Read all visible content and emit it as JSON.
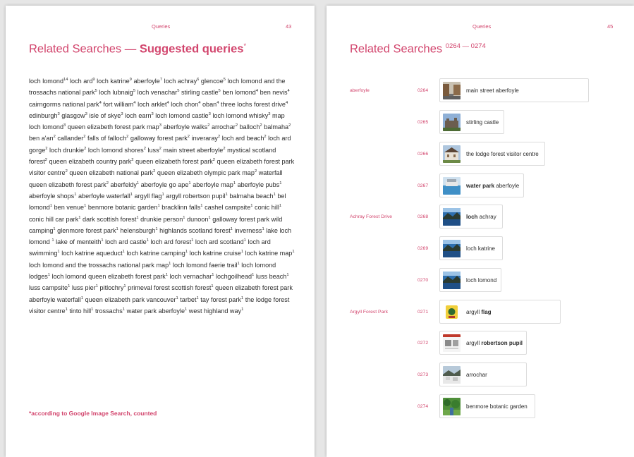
{
  "left_page": {
    "section": "Queries",
    "page_number": "43",
    "title_light": "Related Searches — ",
    "title_bold": "Suggested queries",
    "title_mark": "*",
    "terms": [
      {
        "t": "loch lomond",
        "n": "14"
      },
      {
        "t": "loch ard",
        "n": "9"
      },
      {
        "t": "loch katrine",
        "n": "9"
      },
      {
        "t": "aberfoyle",
        "n": "7"
      },
      {
        "t": "loch achray",
        "n": "6"
      },
      {
        "t": "glencoe",
        "n": "5"
      },
      {
        "t": "loch lomond and the trossachs national park",
        "n": "5"
      },
      {
        "t": "loch lubnaig",
        "n": "5"
      },
      {
        "t": "loch venachar",
        "n": "5"
      },
      {
        "t": "stirling castle",
        "n": "5"
      },
      {
        "t": "ben lomond",
        "n": "4"
      },
      {
        "t": "ben nevis",
        "n": "4"
      },
      {
        "t": "cairngorms national park",
        "n": "4"
      },
      {
        "t": "fort william",
        "n": "4"
      },
      {
        "t": "loch arklet",
        "n": "4"
      },
      {
        "t": "loch chon",
        "n": "4"
      },
      {
        "t": "oban",
        "n": "4"
      },
      {
        "t": "three lochs forest drive",
        "n": "4"
      },
      {
        "t": "edinburgh",
        "n": "3"
      },
      {
        "t": "glasgow",
        "n": "3"
      },
      {
        "t": "isle of skye",
        "n": "3"
      },
      {
        "t": "loch earn",
        "n": "3"
      },
      {
        "t": "loch lomond castle",
        "n": "3"
      },
      {
        "t": "loch lomond whisky",
        "n": "3"
      },
      {
        "t": "map loch lomond",
        "n": "3"
      },
      {
        "t": "queen elizabeth forest park map",
        "n": "3"
      },
      {
        "t": "aberfoyle walks",
        "n": "2"
      },
      {
        "t": "arrochar",
        "n": "2"
      },
      {
        "t": "balloch",
        "n": "2"
      },
      {
        "t": "balmaha",
        "n": "2"
      },
      {
        "t": "ben a'an",
        "n": "2"
      },
      {
        "t": "callander",
        "n": "2"
      },
      {
        "t": "falls of falloch",
        "n": "2"
      },
      {
        "t": "galloway forest park",
        "n": "2"
      },
      {
        "t": "inveraray",
        "n": "2"
      },
      {
        "t": "loch ard beach",
        "n": "2"
      },
      {
        "t": "loch ard gorge",
        "n": "2"
      },
      {
        "t": "loch drunkie",
        "n": "2"
      },
      {
        "t": "loch lomond shores",
        "n": "2"
      },
      {
        "t": "luss",
        "n": "2"
      },
      {
        "t": "main street aberfoyle",
        "n": "2"
      },
      {
        "t": "mystical scotland forest",
        "n": "2"
      },
      {
        "t": "queen elizabeth country park",
        "n": "2"
      },
      {
        "t": "queen elizabeth forest park",
        "n": "2"
      },
      {
        "t": "queen elizabeth forest park visitor centre",
        "n": "2"
      },
      {
        "t": "queen elizabeth national park",
        "n": "2"
      },
      {
        "t": "queen elizabeth olympic park map",
        "n": "2"
      },
      {
        "t": "waterfall queen elizabeth forest park",
        "n": "2"
      },
      {
        "t": "aberfeldy",
        "n": "1"
      },
      {
        "t": "aberfoyle go ape",
        "n": "1"
      },
      {
        "t": "aberfoyle map",
        "n": "1"
      },
      {
        "t": "aberfoyle pubs",
        "n": "1"
      },
      {
        "t": "aberfoyle shops",
        "n": "1"
      },
      {
        "t": "aberfoyle waterfall",
        "n": "1"
      },
      {
        "t": "argyll flag",
        "n": "1"
      },
      {
        "t": "argyll robertson pupil",
        "n": "1"
      },
      {
        "t": "balmaha beach",
        "n": "1"
      },
      {
        "t": "bel lomond",
        "n": "1"
      },
      {
        "t": "ben venue",
        "n": "1"
      },
      {
        "t": "benmore botanic garden",
        "n": "1"
      },
      {
        "t": "bracklinn falls",
        "n": "1"
      },
      {
        "t": "cashel campsite",
        "n": "1"
      },
      {
        "t": "conic hill",
        "n": "1"
      },
      {
        "t": "conic hill car park",
        "n": "1"
      },
      {
        "t": "dark scottish forest",
        "n": "1"
      },
      {
        "t": "drunkie person",
        "n": "1"
      },
      {
        "t": "dunoon",
        "n": "1"
      },
      {
        "t": "galloway forest park wild camping",
        "n": "1"
      },
      {
        "t": "glenmore forest park",
        "n": "1"
      },
      {
        "t": "helensburgh",
        "n": "1"
      },
      {
        "t": "highlands scotland forest",
        "n": "1"
      },
      {
        "t": "inverness",
        "n": "1"
      },
      {
        "t": "lake loch lomond ",
        "n": "1"
      },
      {
        "t": "lake of menteith",
        "n": "1"
      },
      {
        "t": "loch ard castle",
        "n": "1"
      },
      {
        "t": "loch ard forest",
        "n": "1"
      },
      {
        "t": "loch ard scotland",
        "n": "1"
      },
      {
        "t": "loch ard swimming",
        "n": "1"
      },
      {
        "t": "loch katrine aqueduct",
        "n": "1"
      },
      {
        "t": "loch katrine camping",
        "n": "1"
      },
      {
        "t": "loch katrine cruise",
        "n": "1"
      },
      {
        "t": "loch katrine map",
        "n": "1"
      },
      {
        "t": "loch lomond and the trossachs national park map",
        "n": "1"
      },
      {
        "t": "loch lomond faerie trail",
        "n": "1"
      },
      {
        "t": "loch lomond lodges",
        "n": "1"
      },
      {
        "t": "loch lomond queen elizabeth forest park",
        "n": "1"
      },
      {
        "t": "loch vernachar",
        "n": "1"
      },
      {
        "t": "lochgoilhead",
        "n": "1"
      },
      {
        "t": "luss beach",
        "n": "1"
      },
      {
        "t": "luss campsite",
        "n": "1"
      },
      {
        "t": "luss pier",
        "n": "1"
      },
      {
        "t": "pitlochry",
        "n": "1"
      },
      {
        "t": "primeval forest scottish forest",
        "n": "1"
      },
      {
        "t": "queen elizabeth forest park aberfoyle waterfall",
        "n": "1"
      },
      {
        "t": "queen elizabeth park vancouver",
        "n": "1"
      },
      {
        "t": "tarbet",
        "n": "1"
      },
      {
        "t": "tay forest park",
        "n": "1"
      },
      {
        "t": "the lodge forest visitor centre",
        "n": "1"
      },
      {
        "t": "tinto hill",
        "n": "1"
      },
      {
        "t": "trossachs",
        "n": "1"
      },
      {
        "t": "water park aberfoyle",
        "n": "1"
      },
      {
        "t": "west highland way",
        "n": "1"
      }
    ],
    "footnote": "*according to Google Image Search, counted"
  },
  "right_page": {
    "section": "Queries",
    "page_number": "45",
    "title": "Related Searches ",
    "title_range": "0264 — 0274",
    "rows": [
      {
        "category": "aberfoyle",
        "num": "0264",
        "pre": "main street aberfoyle",
        "bold": "",
        "post": "",
        "icon": "street-photo-icon"
      },
      {
        "category": "",
        "num": "0265",
        "pre": "stirling castle",
        "bold": "",
        "post": "",
        "icon": "castle-photo-icon"
      },
      {
        "category": "",
        "num": "0266",
        "pre": "the lodge forest visitor centre",
        "bold": "",
        "post": "",
        "icon": "lodge-photo-icon"
      },
      {
        "category": "",
        "num": "0267",
        "pre": "",
        "bold": "water park",
        "post": " aberfoyle",
        "icon": "water-park-photo-icon"
      },
      {
        "category": "Achray Forest Drive",
        "num": "0268",
        "pre": "",
        "bold": "loch",
        "post": " achray",
        "icon": "loch-photo-icon"
      },
      {
        "category": "",
        "num": "0269",
        "pre": "loch katrine",
        "bold": "",
        "post": "",
        "icon": "loch-photo-icon"
      },
      {
        "category": "",
        "num": "0270",
        "pre": "loch lomond",
        "bold": "",
        "post": "",
        "icon": "loch-photo-icon"
      },
      {
        "category": "Argyll Forest Park",
        "num": "0271",
        "pre": "argyll ",
        "bold": "flag",
        "post": "",
        "icon": "flag-emblem-icon"
      },
      {
        "category": "",
        "num": "0272",
        "pre": "argyll ",
        "bold": "robertson pupil",
        "post": "",
        "icon": "document-thumb-icon"
      },
      {
        "category": "",
        "num": "0273",
        "pre": "arrochar",
        "bold": "",
        "post": "",
        "icon": "village-photo-icon"
      },
      {
        "category": "",
        "num": "0274",
        "pre": "benmore botanic garden",
        "bold": "",
        "post": "",
        "icon": "garden-photo-icon"
      }
    ]
  }
}
